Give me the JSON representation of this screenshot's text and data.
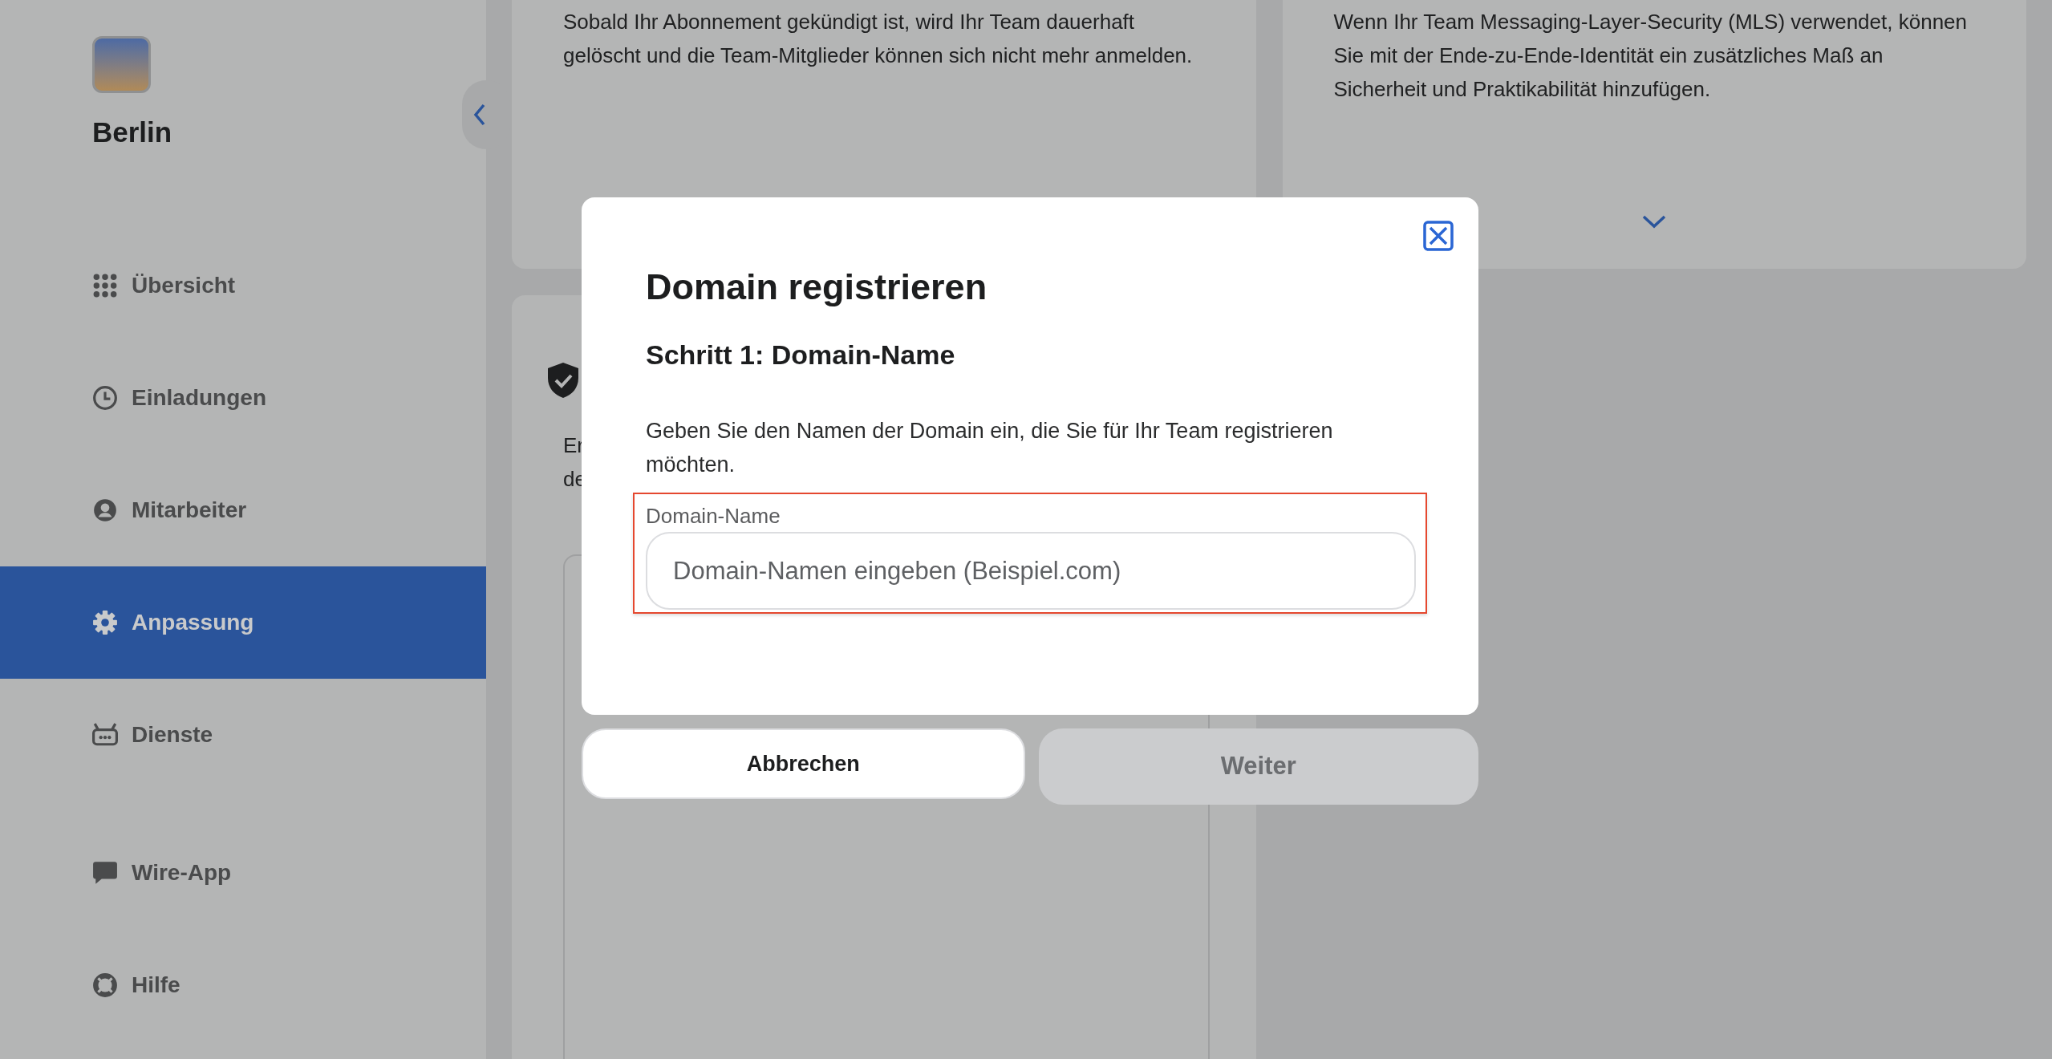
{
  "sidebar": {
    "team_name": "Berlin",
    "items": [
      {
        "label": "Übersicht",
        "selected": false
      },
      {
        "label": "Einladungen",
        "selected": false
      },
      {
        "label": "Mitarbeiter",
        "selected": false
      },
      {
        "label": "Anpassung",
        "selected": true
      },
      {
        "label": "Dienste",
        "selected": false
      },
      {
        "label": "Wire-App",
        "selected": false
      },
      {
        "label": "Hilfe",
        "selected": false
      }
    ]
  },
  "cards": [
    {
      "text": "Sobald Ihr Abonnement gekündigt ist, wird Ihr Team dauerhaft gelöscht und die Team-Mitglieder können sich nicht mehr anmelden."
    },
    {
      "text": "Wenn Ihr Team Messaging-Layer-Security (MLS) verwendet, können Sie mit der Ende-zu-Ende-Identität ein zusätzliches Maß an Sicherheit und Praktikabilität hinzufügen."
    },
    {
      "text_fragments": [
        "Er",
        "de"
      ]
    }
  ],
  "dialog": {
    "title": "Domain registrieren",
    "step": "Schritt 1: Domain-Name",
    "description": "Geben Sie den Namen der Domain ein, die Sie für Ihr Team registrieren möchten.",
    "field": {
      "label": "Domain-Name",
      "placeholder": "Domain-Namen eingeben (Beispiel.com)"
    },
    "buttons": [
      {
        "label": "Abbrechen",
        "disabled": false
      },
      {
        "label": "Weiter",
        "disabled": true
      }
    ]
  }
}
